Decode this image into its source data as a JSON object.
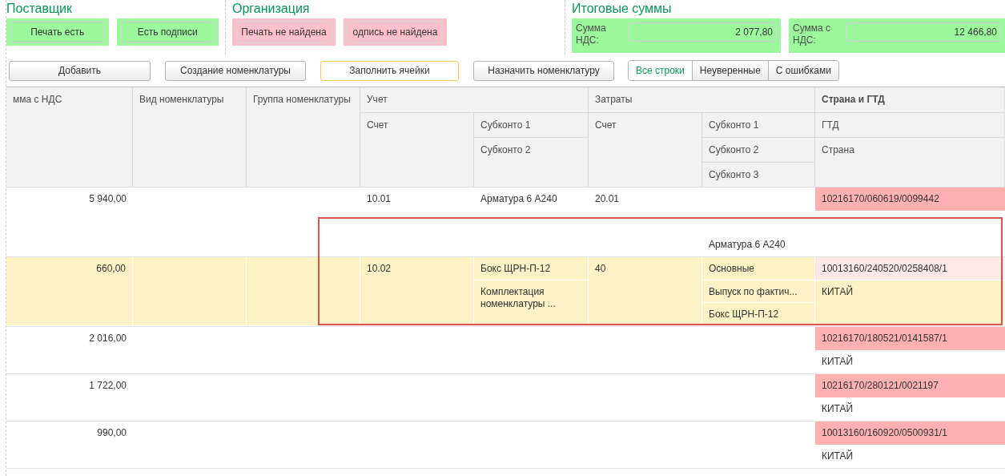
{
  "groups": [
    {
      "title": "Поставщик",
      "badges": [
        {
          "label": "Печать есть",
          "found": true
        },
        {
          "label": "Есть подписи",
          "found": true
        }
      ]
    },
    {
      "title": "Организация",
      "badges": [
        {
          "label": "Печать не найдена",
          "found": false
        },
        {
          "label": "одпись не найдена",
          "found": false
        }
      ]
    }
  ],
  "totals": {
    "title": "Итоговые суммы",
    "fields": [
      {
        "label": "Сумма НДС:",
        "value": "2 077,80"
      },
      {
        "label": "Сумма с НДС:",
        "value": "12 466,80"
      }
    ]
  },
  "toolbar": {
    "buttons": [
      {
        "label": "Добавить",
        "focused": false
      },
      {
        "label": "Создание номенклатуры",
        "focused": false
      },
      {
        "label": "Заполнить ячейки",
        "focused": true
      },
      {
        "label": "Назначить номенклатуру",
        "focused": false
      }
    ],
    "filters": [
      {
        "label": "Все строки",
        "selected": true
      },
      {
        "label": "Неуверенные",
        "selected": false
      },
      {
        "label": "С ошибками",
        "selected": false
      }
    ]
  },
  "table": {
    "header": {
      "sum": "мма с НДС",
      "kind": "Вид номенклатуры",
      "group": "Группа номенклатуры",
      "accounting": "Учет",
      "accounting_account": "Счет",
      "accounting_subkonto_1": "Субконто 1",
      "accounting_subkonto_2": "Субконто 2",
      "costs": "Затраты",
      "costs_account": "Счет",
      "costs_subkonto_1": "Субконто 1",
      "costs_subkonto_2": "Субконто 2",
      "costs_subkonto_3": "Субконто 3",
      "country_gtd": "Страна и ГТД",
      "gtd": "ГТД",
      "country": "Страна"
    },
    "rows": [
      {
        "selected": false,
        "sum": "5 940,00",
        "account": "10.01",
        "subkonto_1": "Арматура 6 А240",
        "cost_account": "20.01",
        "cost_subkonto_3": "Арматура 6 А240",
        "gtd": "10216170/060619/0099442",
        "gtd_invalid": true
      },
      {
        "selected": true,
        "sum": "660,00",
        "account": "10.02",
        "subkonto_1": "Бокс ЩРН-П-12",
        "subkonto_2": "Комплектация номенклатуры ...",
        "cost_account": "40",
        "cost_subkonto_1": "Основные",
        "cost_subkonto_2": "Выпуск по фактич...",
        "cost_subkonto_3": "Бокс ЩРН-П-12",
        "gtd": "10013160/240520/0258408/1",
        "gtd_invalid": true,
        "country": "КИТАЙ"
      },
      {
        "selected": false,
        "sum": "2 016,00",
        "gtd": "10216170/180521/0141587/1",
        "gtd_invalid": true,
        "country": "КИТАЙ"
      },
      {
        "selected": false,
        "sum": "1 722,00",
        "gtd": "10216170/280121/0021197",
        "gtd_invalid": true,
        "country": "КИТАЙ"
      },
      {
        "selected": false,
        "sum": "990,00",
        "gtd": "10013160/160920/0500931/1",
        "gtd_invalid": true,
        "country": "КИТАЙ"
      }
    ]
  }
}
